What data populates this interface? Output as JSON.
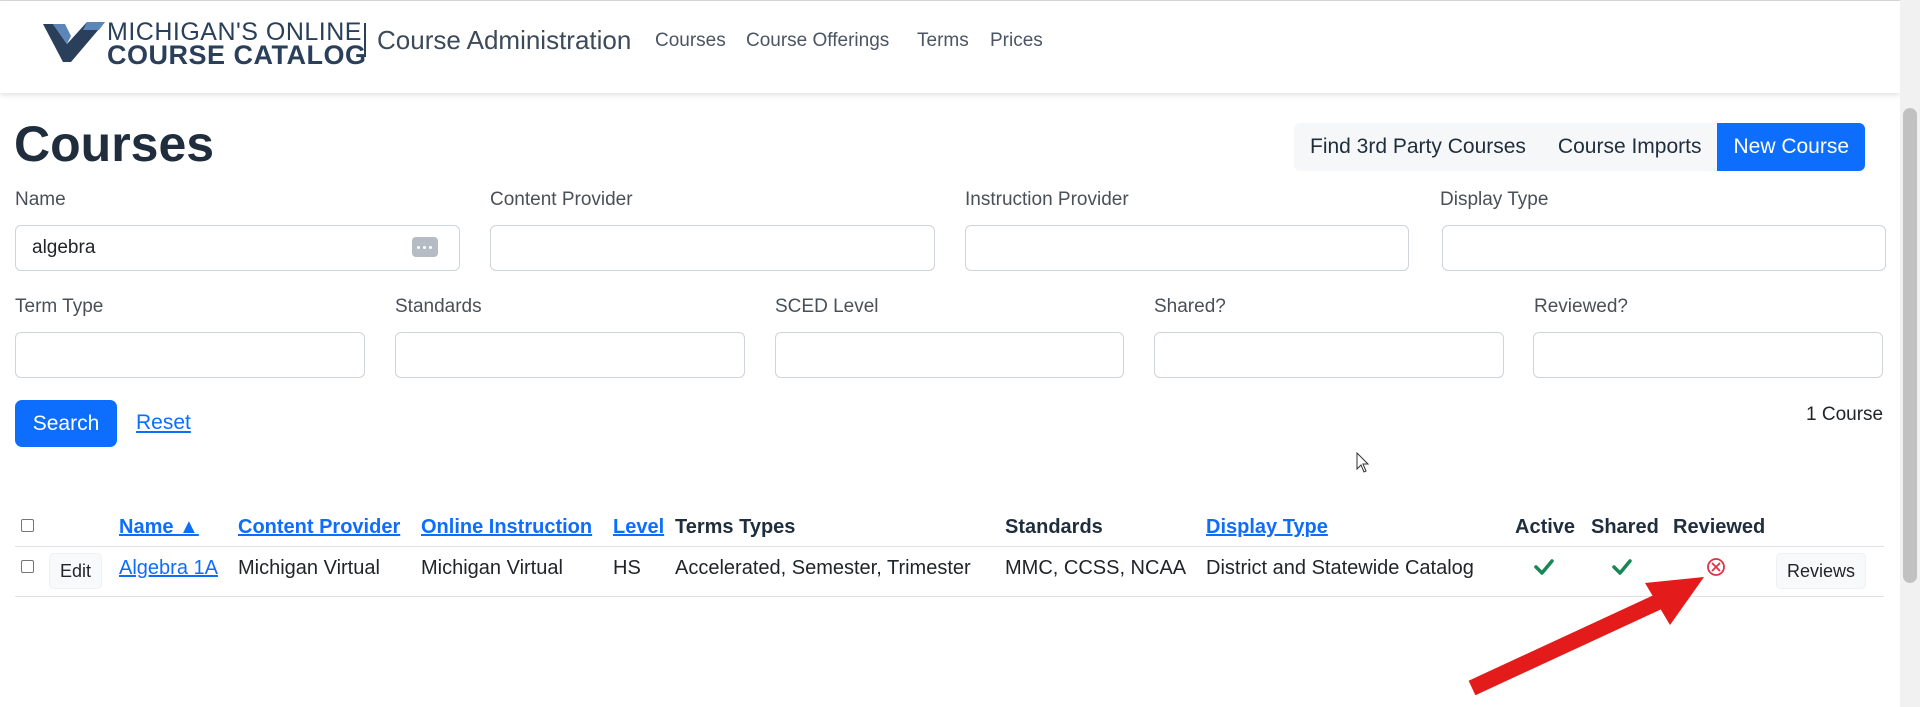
{
  "brand": {
    "logo_line1": "MICHIGAN'S ONLINE",
    "logo_line2": "COURSE CATALOG",
    "title": "Course Administration"
  },
  "nav": [
    "Courses",
    "Course Offerings",
    "Terms",
    "Prices"
  ],
  "page": {
    "title": "Courses",
    "actions": {
      "find_third_party": "Find 3rd Party Courses",
      "course_imports": "Course Imports",
      "new_course": "New Course"
    }
  },
  "filters": {
    "name": {
      "label": "Name",
      "value": "algebra"
    },
    "content_provider": {
      "label": "Content Provider",
      "value": ""
    },
    "instruction_provider": {
      "label": "Instruction Provider",
      "value": ""
    },
    "display_type": {
      "label": "Display Type",
      "value": ""
    },
    "term_type": {
      "label": "Term Type",
      "value": ""
    },
    "standards": {
      "label": "Standards",
      "value": ""
    },
    "sced_level": {
      "label": "SCED Level",
      "value": ""
    },
    "shared": {
      "label": "Shared?",
      "value": ""
    },
    "reviewed": {
      "label": "Reviewed?",
      "value": ""
    },
    "search_label": "Search",
    "reset_label": "Reset"
  },
  "results": {
    "count_text": "1 Course"
  },
  "table": {
    "headers": {
      "name": "Name ▲",
      "content_provider": "Content Provider",
      "online_instruction": "Online Instruction",
      "level": "Level",
      "terms_types": "Terms Types",
      "standards": "Standards",
      "display_type": "Display Type",
      "active": "Active",
      "shared": "Shared",
      "reviewed": "Reviewed"
    },
    "rows": [
      {
        "edit_label": "Edit",
        "name": "Algebra 1A",
        "content_provider": "Michigan Virtual",
        "online_instruction": "Michigan Virtual",
        "level": "HS",
        "terms_types": "Accelerated, Semester, Trimester",
        "standards": "MMC, CCSS, NCAA",
        "display_type": "District and Statewide Catalog",
        "active": true,
        "shared": true,
        "reviewed": false,
        "reviews_label": "Reviews"
      }
    ]
  },
  "colors": {
    "primary": "#0d6efd",
    "check": "#198754",
    "reviewed_x": "#dc3545",
    "annotation_arrow": "#e31b1b"
  },
  "icons": {
    "active": "check-icon",
    "shared": "check-icon",
    "reviewed": "x-circle-icon",
    "name_field": "password-dots-icon"
  }
}
